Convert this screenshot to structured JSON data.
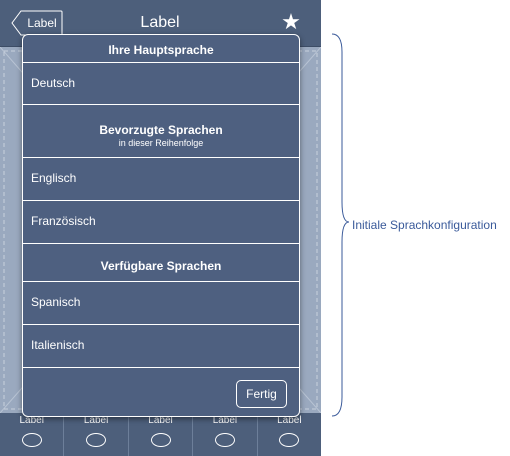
{
  "navbar": {
    "back_label": "Label",
    "title": "Label",
    "star_icon": "star-icon"
  },
  "popover": {
    "primary_header": "Ihre Hauptsprache",
    "primary_item": "Deutsch",
    "preferred_header": "Bevorzugte Sprachen",
    "preferred_subheader": "in dieser Reihenfolge",
    "preferred_items": [
      "Englisch",
      "Französisch"
    ],
    "available_header": "Verfügbare Sprachen",
    "available_items": [
      "Spanisch",
      "Italienisch"
    ],
    "done_label": "Fertig"
  },
  "tabbar": {
    "tabs": [
      {
        "label": "Label"
      },
      {
        "label": "Label"
      },
      {
        "label": "Label"
      },
      {
        "label": "Label"
      },
      {
        "label": "Label"
      }
    ]
  },
  "annotation": {
    "text": "Initiale Sprachkonfiguration"
  },
  "colors": {
    "navbar": "#4d5f7b",
    "popover": "#4e6080",
    "annotation": "#3a5a9a"
  }
}
